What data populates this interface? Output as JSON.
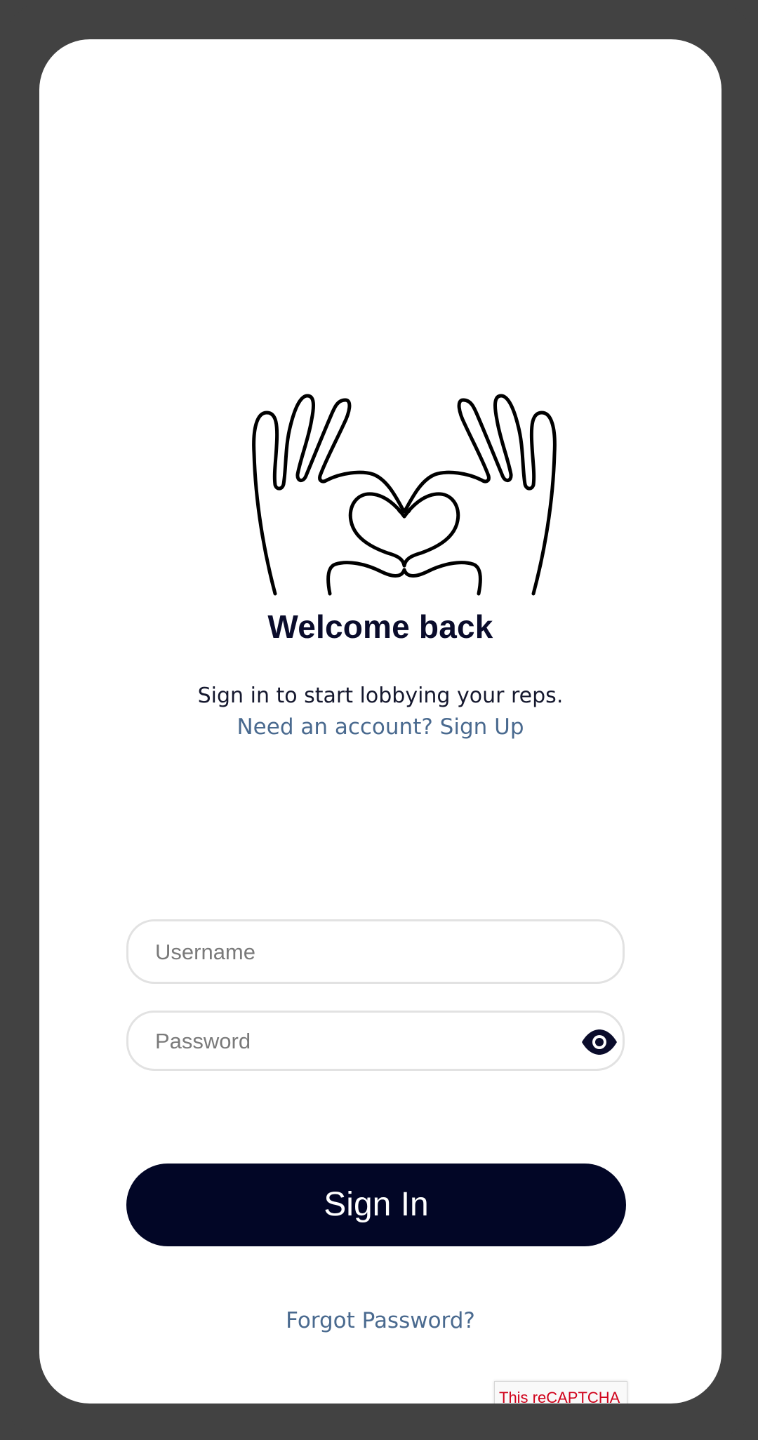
{
  "screen": {
    "title": "Welcome back",
    "subtitle": "Sign in to start lobbying your reps.",
    "signup_link": "Need an account? Sign Up"
  },
  "illustration": {
    "icon": "heart-hands-icon"
  },
  "form": {
    "username_placeholder": "Username",
    "password_placeholder": "Password",
    "show_password_icon": "eye-icon",
    "sign_in_label": "Sign In",
    "forgot_password_label": "Forgot Password?"
  },
  "recaptcha": {
    "text": "This reCAPTCHA"
  },
  "colors": {
    "primary": "#020626",
    "link": "#4a6a8f",
    "heading": "#0a0c2b",
    "frame": "#424242",
    "recaptcha_error": "#d0021b"
  }
}
